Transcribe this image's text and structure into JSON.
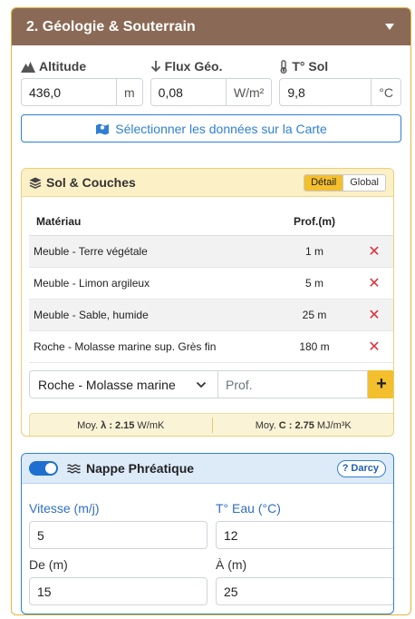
{
  "panel": {
    "title": "2. Géologie & Souterrain"
  },
  "metrics": [
    {
      "label": "Altitude",
      "value": "436,0",
      "unit": "m"
    },
    {
      "label": "Flux Géo.",
      "value": "0,08",
      "unit": "W/m²"
    },
    {
      "label": "T° Sol",
      "value": "9,8",
      "unit": "°C"
    }
  ],
  "map_button": {
    "label": "Sélectionner les données sur la Carte"
  },
  "soil": {
    "title": "Sol & Couches",
    "toggle": {
      "detail": "Détail",
      "global": "Global"
    },
    "table": {
      "headers": {
        "material": "Matériau",
        "prof": "Prof.(m)"
      },
      "rows": [
        {
          "material": "Meuble - Terre végétale",
          "prof": "1 m"
        },
        {
          "material": "Meuble - Limon argileux",
          "prof": "5 m"
        },
        {
          "material": "Meuble - Sable, humide",
          "prof": "25 m"
        },
        {
          "material": "Roche - Molasse marine sup. Grès fin",
          "prof": "180 m"
        }
      ]
    },
    "add": {
      "selected": "Roche - Molasse marine",
      "prof_placeholder": "Prof.",
      "add_label": "+"
    },
    "averages": {
      "lambda_prefix": "Moy.",
      "lambda_symbol": "λ :",
      "lambda_value": "2.15",
      "lambda_unit": "W/mK",
      "c_prefix": "Moy.",
      "c_symbol": "C :",
      "c_value": "2.75",
      "c_unit": "MJ/m³K"
    }
  },
  "nappe": {
    "title": "Nappe Phréatique",
    "enabled": true,
    "help_label": "Darcy",
    "fields": {
      "vitesse": {
        "label": "Vitesse (m/j)",
        "value": "5"
      },
      "t_eau": {
        "label": "T° Eau (°C)",
        "value": "12"
      },
      "de": {
        "label": "De (m)",
        "value": "15"
      },
      "a": {
        "label": "À (m)",
        "value": "25"
      }
    }
  },
  "colors": {
    "header_bg": "#8a6a56",
    "accent_yellow": "#f3bf2c",
    "accent_blue": "#2f7fd1",
    "delete_red": "#d9303e"
  }
}
